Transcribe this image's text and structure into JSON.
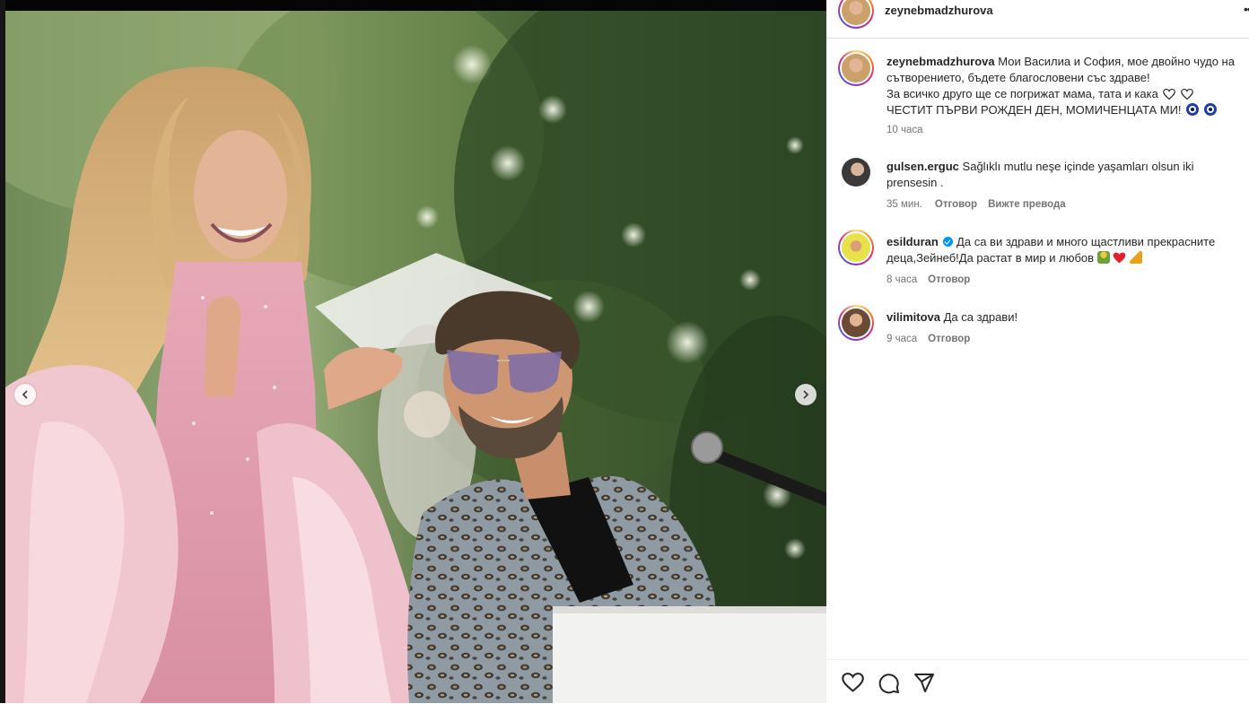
{
  "post": {
    "author": "zeynebmadzhurova",
    "more_label": "•••",
    "caption_author": "zeynebmadzhurova",
    "caption_line1": "Мои Василиа и София, мое двойно чудо на сътворението, бъдете благословени със здраве!",
    "caption_line2": "За всичко друго ще се погрижат мама, тата и кака",
    "caption_line3": "ЧЕСТИТ ПЪРВИ РОЖДЕН ДЕН, МОМИЧЕНЦАТА МИ!",
    "caption_time": "10 часа"
  },
  "comments": [
    {
      "user": "gulsen.erguc",
      "text": "Sağlıklı mutlu neşe içinde yaşamları olsun iki prensesin .",
      "time": "35 мин.",
      "reply": "Отговор",
      "translate": "Вижте превода"
    },
    {
      "user": "esilduran",
      "verified": true,
      "text": "Да са ви здрави и много щастливи прекрасните деца,Зейнеб!Да растат в мир и любов",
      "time": "8 часа",
      "reply": "Отговор"
    },
    {
      "user": "vilimitova",
      "text": "Да са здрави!",
      "time": "9 часа",
      "reply": "Отговор"
    }
  ],
  "icons": {
    "prev": "chevron-left-icon",
    "next": "chevron-right-icon",
    "like": "heart-icon",
    "comment": "comment-icon",
    "share": "share-icon"
  },
  "colors": {
    "link_blue": "#0095f6",
    "text_primary": "#262626",
    "text_secondary": "#737373",
    "divider": "#dbdbdb"
  }
}
